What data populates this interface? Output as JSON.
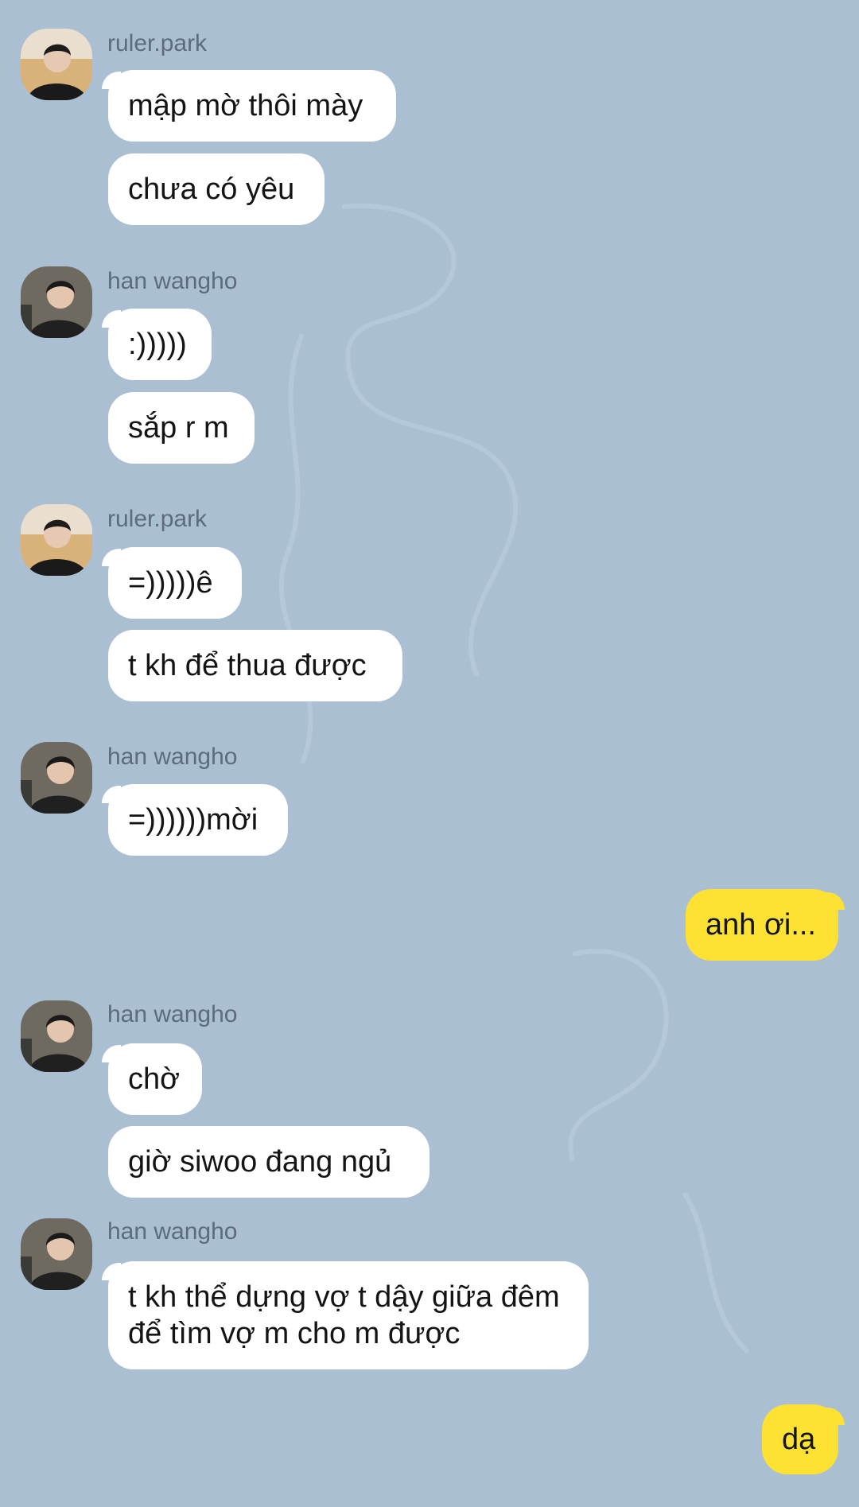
{
  "colors": {
    "background": "#abbfd3",
    "incoming_bubble": "#ffffff",
    "outgoing_bubble": "#fde234",
    "sender_name": "#5d6b7c"
  },
  "chat": {
    "groups": [
      {
        "sender": "ruler.park",
        "avatar": "ruler-park-avatar",
        "messages": [
          "mập mờ thôi mày",
          "chưa có yêu"
        ]
      },
      {
        "sender": "han wangho",
        "avatar": "han-wangho-avatar",
        "messages": [
          ":)))))",
          "sắp r m"
        ]
      },
      {
        "sender": "ruler.park",
        "avatar": "ruler-park-avatar",
        "messages": [
          "=)))))ê",
          "t kh để thua được"
        ]
      },
      {
        "sender": "han wangho",
        "avatar": "han-wangho-avatar",
        "messages": [
          "=))))))mời"
        ]
      },
      {
        "sender": "me",
        "messages": [
          "anh ơi..."
        ]
      },
      {
        "sender": "han wangho",
        "avatar": "han-wangho-avatar",
        "messages": [
          "chờ",
          "giờ siwoo đang ngủ"
        ]
      },
      {
        "sender": "han wangho",
        "avatar": "han-wangho-avatar",
        "messages": [
          "t kh thể dựng vợ t dậy giữa đêm để tìm vợ m cho m được"
        ]
      },
      {
        "sender": "me",
        "messages": [
          "dạ"
        ]
      }
    ]
  }
}
